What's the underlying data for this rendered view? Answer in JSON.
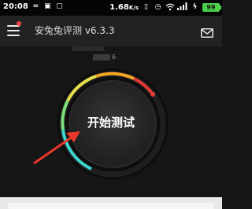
{
  "status_bar": {
    "time": "20:08",
    "speed": "1.68",
    "speed_unit": "K/s",
    "battery": "99"
  },
  "header": {
    "title": "安兔兔评测 v6.3.3"
  },
  "info": {
    "visible_suffix": "6"
  },
  "main": {
    "start_button_label": "开始测试"
  },
  "colors": {
    "accent_red": "#e53935",
    "gauge_orange": "#f5a623",
    "gauge_yellow": "#e8e04a",
    "gauge_cyan": "#3ed6d0",
    "annotation_arrow": "#e8382c"
  },
  "icons": {
    "menu": "menu-icon",
    "mail": "mail-icon",
    "wifi": "wifi-icon",
    "signal": "signal-icon"
  }
}
